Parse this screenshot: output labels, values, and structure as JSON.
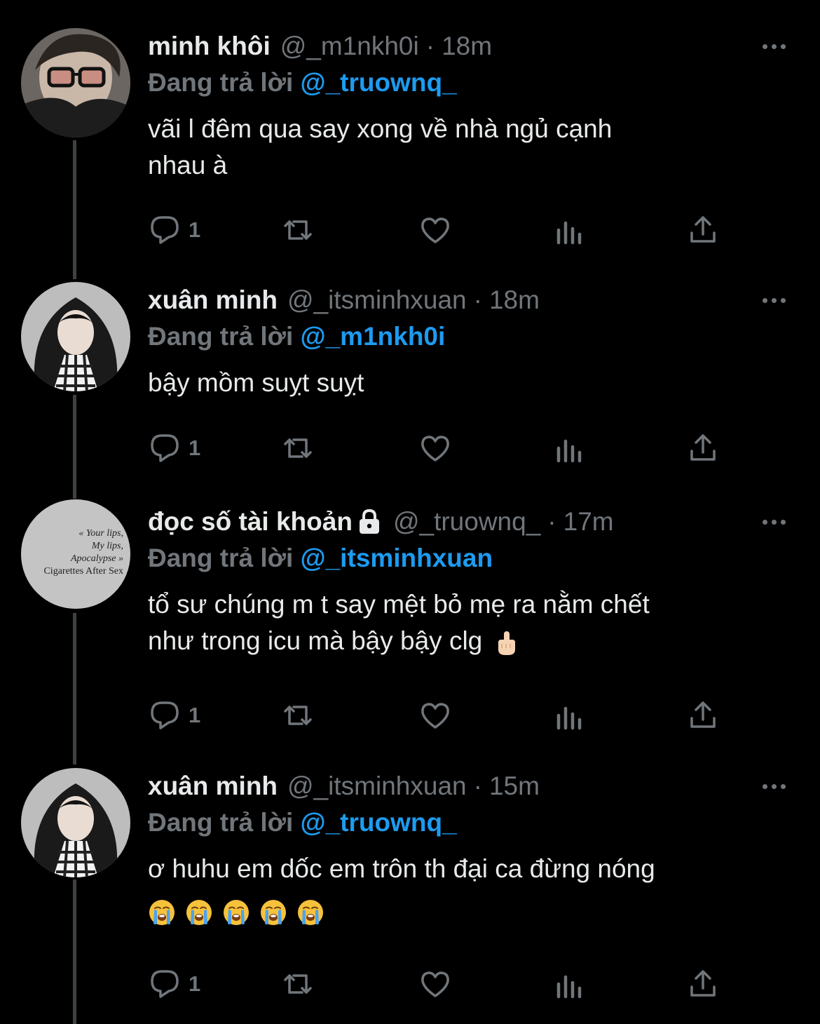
{
  "reply_prefix": "Đang trả lời",
  "colors": {
    "background": "#000000",
    "text": "#e7e9ea",
    "muted": "#71767b",
    "mention": "#1d9bf0",
    "thread_line": "#3e4144"
  },
  "tweets": [
    {
      "name": "minh khôi",
      "handle": "@_m1nkh0i",
      "separator": "·",
      "time": "18m",
      "replying_to": "@_truownq_",
      "text": "vãi l đêm qua say xong về nhà ngủ cạnh\nnhau à",
      "avatar": "avatar-glasses-icon",
      "reply_count": "1",
      "lock": false
    },
    {
      "name": "xuân minh",
      "handle": "@_itsminhxuan",
      "separator": "·",
      "time": "18m",
      "replying_to": "@_m1nkh0i",
      "text": "bậy mồm suỵt suỵt",
      "avatar": "avatar-hoodie-icon",
      "reply_count": "1",
      "lock": false
    },
    {
      "name": "đọc số tài khoản",
      "handle": "@_truownq_",
      "separator": "·",
      "time": "17m",
      "replying_to": "@_itsminhxuan",
      "text": "tổ sư chúng m t say mệt bỏ mẹ ra nằm chết\nnhư trong icu mà bậy bậy clg",
      "text_emoji": "middle-finger-emoji",
      "avatar": "avatar-lyrics-icon",
      "avatar_text": [
        "« Your lips,",
        "My lips,",
        "Apocalypse »",
        "Cigarettes After Sex"
      ],
      "reply_count": "1",
      "lock": true
    },
    {
      "name": "xuân minh",
      "handle": "@_itsminhxuan",
      "separator": "·",
      "time": "15m",
      "replying_to": "@_truownq_",
      "text": "ơ huhu em dốc em trôn th đại ca đừng nóng",
      "text_emojis": [
        "loudly-crying-emoji",
        "loudly-crying-emoji",
        "loudly-crying-emoji",
        "loudly-crying-emoji",
        "loudly-crying-emoji"
      ],
      "avatar": "avatar-hoodie-icon",
      "reply_count": "1",
      "lock": false
    }
  ]
}
